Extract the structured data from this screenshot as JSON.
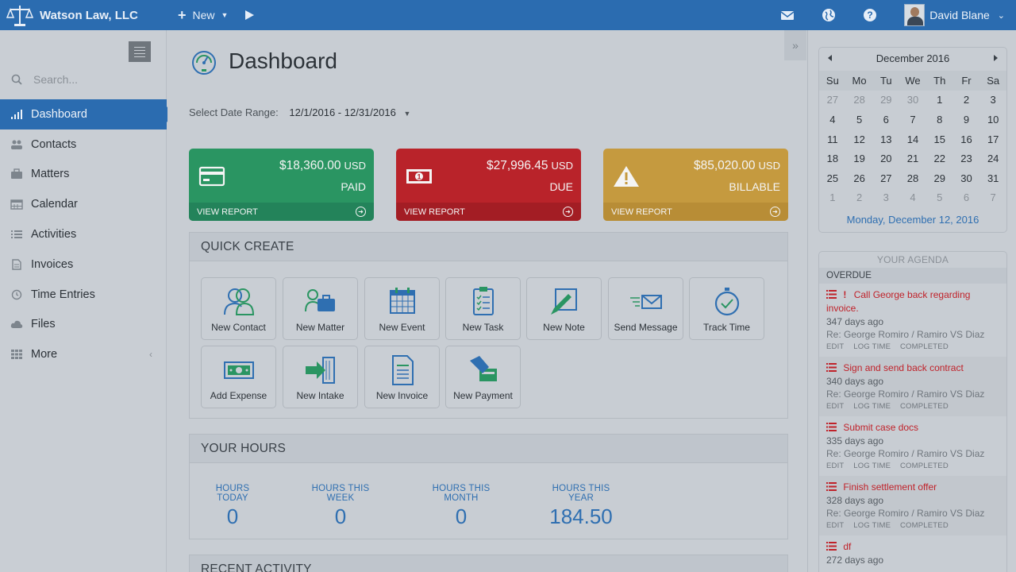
{
  "topbar": {
    "brand": "Watson Law, LLC",
    "new_label": "New",
    "user_name": "David Blane"
  },
  "sidebar": {
    "search_placeholder": "Search...",
    "items": [
      {
        "label": "Dashboard",
        "icon": "bar-chart-icon"
      },
      {
        "label": "Contacts",
        "icon": "people-icon"
      },
      {
        "label": "Matters",
        "icon": "briefcase-icon"
      },
      {
        "label": "Calendar",
        "icon": "calendar-icon"
      },
      {
        "label": "Activities",
        "icon": "list-icon"
      },
      {
        "label": "Invoices",
        "icon": "document-icon"
      },
      {
        "label": "Time Entries",
        "icon": "clock-icon"
      },
      {
        "label": "Files",
        "icon": "cloud-icon"
      },
      {
        "label": "More",
        "icon": "grid-icon"
      }
    ]
  },
  "main": {
    "title": "Dashboard",
    "date_range_label": "Select Date Range:",
    "date_range_value": "12/1/2016 - 12/31/2016",
    "cards": {
      "paid": {
        "amount": "$18,360.00",
        "currency": "USD",
        "label": "PAID",
        "link": "VIEW REPORT",
        "color": "#2a9562"
      },
      "due": {
        "amount": "$27,996.45",
        "currency": "USD",
        "label": "DUE",
        "link": "VIEW REPORT",
        "color": "#b9232a"
      },
      "billable": {
        "amount": "$85,020.00",
        "currency": "USD",
        "label": "BILLABLE",
        "link": "VIEW REPORT",
        "color": "#c59a3f"
      }
    },
    "quick_create": {
      "title": "QUICK CREATE",
      "tiles": [
        {
          "label": "New Contact",
          "icon": "contacts-icon"
        },
        {
          "label": "New Matter",
          "icon": "matter-icon"
        },
        {
          "label": "New Event",
          "icon": "event-calendar-icon"
        },
        {
          "label": "New Task",
          "icon": "clipboard-icon"
        },
        {
          "label": "New Note",
          "icon": "note-icon"
        },
        {
          "label": "Send Message",
          "icon": "envelope-icon"
        },
        {
          "label": "Track Time",
          "icon": "stopwatch-icon"
        },
        {
          "label": "Add Expense",
          "icon": "cash-icon"
        },
        {
          "label": "New Intake",
          "icon": "intake-icon"
        },
        {
          "label": "New Invoice",
          "icon": "invoice-icon"
        },
        {
          "label": "New Payment",
          "icon": "payment-icon"
        }
      ]
    },
    "hours": {
      "title": "YOUR HOURS",
      "today": {
        "label": "HOURS TODAY",
        "value": "0"
      },
      "week": {
        "label": "HOURS THIS WEEK",
        "value": "0"
      },
      "month": {
        "label": "HOURS THIS MONTH",
        "value": "0"
      },
      "year": {
        "label": "HOURS THIS YEAR",
        "value": "184.50"
      }
    },
    "recent": {
      "title": "RECENT ACTIVITY"
    }
  },
  "calendar": {
    "month": "December 2016",
    "dow": [
      "Su",
      "Mo",
      "Tu",
      "We",
      "Th",
      "Fr",
      "Sa"
    ],
    "weeks": [
      [
        "27",
        "28",
        "29",
        "30",
        "1",
        "2",
        "3"
      ],
      [
        "4",
        "5",
        "6",
        "7",
        "8",
        "9",
        "10"
      ],
      [
        "11",
        "12",
        "13",
        "14",
        "15",
        "16",
        "17"
      ],
      [
        "18",
        "19",
        "20",
        "21",
        "22",
        "23",
        "24"
      ],
      [
        "25",
        "26",
        "27",
        "28",
        "29",
        "30",
        "31"
      ],
      [
        "1",
        "2",
        "3",
        "4",
        "5",
        "6",
        "7"
      ]
    ],
    "selected_text": "Monday, December 12, 2016"
  },
  "agenda": {
    "title": "YOUR AGENDA",
    "section": "OVERDUE",
    "actions": [
      "EDIT",
      "LOG TIME",
      "COMPLETED"
    ],
    "tasks": [
      {
        "title": "Call George back regarding invoice.",
        "ago": "347 days ago",
        "re": "Re: George Romiro / Ramiro VS Diaz",
        "urgent": true
      },
      {
        "title": "Sign and send back contract",
        "ago": "340 days ago",
        "re": "Re: George Romiro / Ramiro VS Diaz",
        "urgent": false
      },
      {
        "title": "Submit case docs",
        "ago": "335 days ago",
        "re": "Re: George Romiro / Ramiro VS Diaz",
        "urgent": false
      },
      {
        "title": "Finish settlement offer",
        "ago": "328 days ago",
        "re": "Re: George Romiro / Ramiro VS Diaz",
        "urgent": false
      },
      {
        "title": "df",
        "ago": "272 days ago",
        "re": "",
        "urgent": false
      }
    ]
  }
}
